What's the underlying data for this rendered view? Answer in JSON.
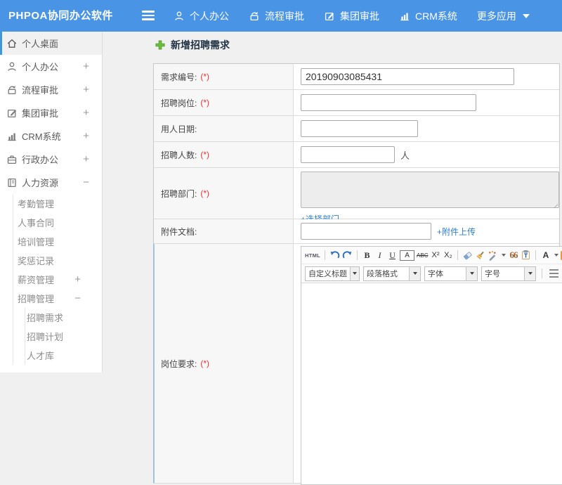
{
  "colors": {
    "topbar_blue": "#4a94e6",
    "link_blue": "#2e7fd1",
    "required_red": "#e53333",
    "active_border_blue": "#3e97d9",
    "title_green": "#6fbf3e"
  },
  "topbar": {
    "logo": "PHPOA协同办公软件",
    "nav": [
      {
        "slug": "personal-office",
        "icon": "user",
        "label": "个人办公"
      },
      {
        "slug": "workflow-approval",
        "icon": "flow",
        "label": "流程审批"
      },
      {
        "slug": "group-approval",
        "icon": "edit",
        "label": "集团审批"
      },
      {
        "slug": "crm-system",
        "icon": "chart",
        "label": "CRM系统"
      },
      {
        "slug": "more-apps",
        "icon": "",
        "label": "更多应用",
        "caret": true
      }
    ]
  },
  "sidebar": {
    "items": [
      {
        "slug": "personal-desktop",
        "label": "个人桌面",
        "icon": "home",
        "level": 0,
        "active": true
      },
      {
        "slug": "personal-office",
        "label": "个人办公",
        "icon": "user",
        "level": 0,
        "expand": "+"
      },
      {
        "slug": "workflow-approval",
        "label": "流程审批",
        "icon": "flow",
        "level": 0,
        "expand": "+"
      },
      {
        "slug": "group-approval",
        "label": "集团审批",
        "icon": "edit",
        "level": 0,
        "expand": "+"
      },
      {
        "slug": "crm-system",
        "label": "CRM系统",
        "icon": "chart",
        "level": 0,
        "expand": "+"
      },
      {
        "slug": "admin-office",
        "label": "行政办公",
        "icon": "briefcase",
        "level": 0,
        "expand": "+"
      },
      {
        "slug": "human-resources",
        "label": "人力资源",
        "icon": "book",
        "level": 0,
        "expand": "-"
      },
      {
        "slug": "attendance-management",
        "label": "考勤管理",
        "level": 1
      },
      {
        "slug": "personnel-contract",
        "label": "人事合同",
        "level": 1
      },
      {
        "slug": "training-management",
        "label": "培训管理",
        "level": 1
      },
      {
        "slug": "reward-punishment-records",
        "label": "奖惩记录",
        "level": 1
      },
      {
        "slug": "salary-management",
        "label": "薪资管理",
        "level": 1,
        "expand": "+"
      },
      {
        "slug": "recruitment-management",
        "label": "招聘管理",
        "level": 1,
        "expand": "-"
      },
      {
        "slug": "recruitment-requirement",
        "label": "招聘需求",
        "level": 2
      },
      {
        "slug": "recruitment-plan",
        "label": "招聘计划",
        "level": 2
      },
      {
        "slug": "talent-pool",
        "label": "人才库",
        "level": 2
      }
    ]
  },
  "main": {
    "title": "新增招聘需求",
    "form": {
      "req_no": {
        "label": "需求编号:",
        "required": "(*)",
        "value": "20190903085431"
      },
      "position": {
        "label": "招聘岗位:",
        "required": "(*)",
        "value": ""
      },
      "date": {
        "label": "用人日期:",
        "value": ""
      },
      "headcount": {
        "label": "招聘人数:",
        "required": "(*)",
        "value": "",
        "suffix": "人"
      },
      "department": {
        "label": "招聘部门:",
        "required": "(*)",
        "link": "+选择部门"
      },
      "attachment": {
        "label": "附件文档:",
        "value": "",
        "link": "+附件上传"
      },
      "requirements": {
        "label": "岗位要求:",
        "required": "(*)"
      }
    },
    "editor": {
      "tools": [
        {
          "name": "html-source-button",
          "label": "HTML"
        },
        {
          "name": "separator"
        },
        {
          "name": "undo-button"
        },
        {
          "name": "redo-button"
        },
        {
          "name": "separator"
        },
        {
          "name": "bold-button",
          "label": "B"
        },
        {
          "name": "italic-button",
          "label": "I"
        },
        {
          "name": "underline-button",
          "label": "U"
        },
        {
          "name": "font-box-button",
          "label": "A"
        },
        {
          "name": "strikethrough-button",
          "label": "ABC"
        },
        {
          "name": "superscript-button",
          "label": "X²"
        },
        {
          "name": "subscript-button",
          "label": "X₂"
        },
        {
          "name": "separator"
        },
        {
          "name": "format-eraser-button"
        },
        {
          "name": "quick-format-button"
        },
        {
          "name": "auto-typeset-button"
        },
        {
          "name": "blockquote-button",
          "label": "66"
        },
        {
          "name": "paste-text-button",
          "label": "T"
        },
        {
          "name": "separator"
        },
        {
          "name": "font-color-button",
          "label": "A"
        },
        {
          "name": "highlight-button",
          "label": "a"
        }
      ],
      "selects": [
        "自定义标题",
        "段落格式",
        "字体",
        "字号"
      ],
      "aligns": [
        "align-left-button",
        "align-center-button",
        "align-right-button",
        "justify-button"
      ]
    }
  }
}
